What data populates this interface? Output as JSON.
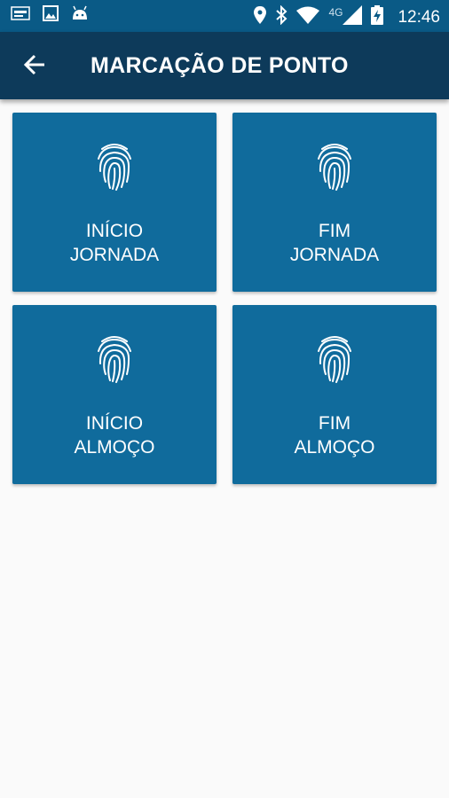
{
  "status_bar": {
    "time": "12:46",
    "network": "4G",
    "left_icons": [
      "photo-badge-icon",
      "image-icon",
      "android-icon"
    ],
    "right_icons": [
      "location-icon",
      "bluetooth-icon",
      "wifi-icon",
      "signal-icon",
      "battery-charging-icon"
    ],
    "background": "#0a5a86"
  },
  "app_bar": {
    "title": "MARCAÇÃO DE PONTO",
    "back_icon": "arrow-left-icon",
    "background": "#0d3a5a"
  },
  "tiles": [
    {
      "line1": "INÍCIO",
      "line2": "JORNADA",
      "icon": "fingerprint-icon"
    },
    {
      "line1": "FIM",
      "line2": "JORNADA",
      "icon": "fingerprint-icon"
    },
    {
      "line1": "INÍCIO",
      "line2": "ALMOÇO",
      "icon": "fingerprint-icon"
    },
    {
      "line1": "FIM",
      "line2": "ALMOÇO",
      "icon": "fingerprint-icon"
    }
  ],
  "colors": {
    "tile": "#106b9c",
    "page_background": "#fafafa"
  }
}
